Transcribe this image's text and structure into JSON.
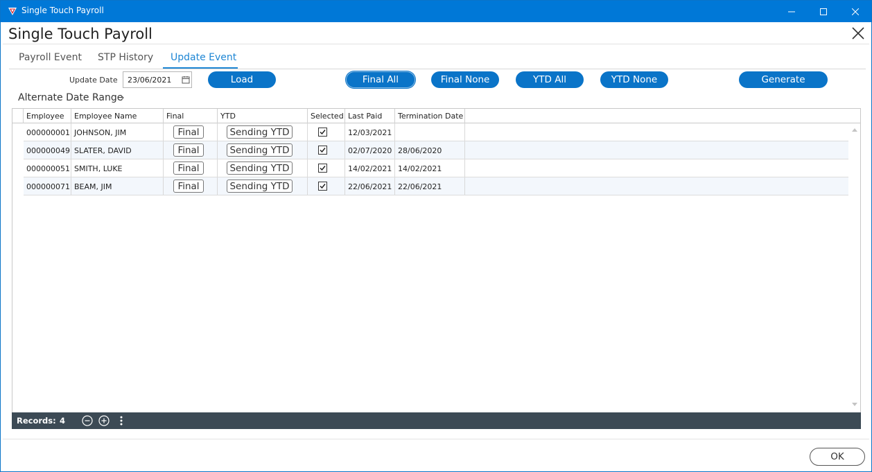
{
  "window": {
    "title": "Single Touch Payroll",
    "controls": [
      "minimize-icon",
      "maximize-icon",
      "close-icon"
    ],
    "accent": "#0078d7"
  },
  "dialog": {
    "title": "Single Touch Payroll"
  },
  "tabs": [
    {
      "label": "Payroll Event",
      "active": false
    },
    {
      "label": "STP History",
      "active": false
    },
    {
      "label": "Update Event",
      "active": true
    }
  ],
  "toolbar": {
    "update_date_label": "Update Date",
    "update_date_value": "23/06/2021",
    "load_label": "Load",
    "final_all_label": "Final All",
    "final_none_label": "Final None",
    "ytd_all_label": "YTD All",
    "ytd_none_label": "YTD None",
    "generate_label": "Generate"
  },
  "alternate_date_range": {
    "label": "Alternate Date Range"
  },
  "grid": {
    "columns": [
      "Employee",
      "Employee Name",
      "Final",
      "YTD",
      "Selected",
      "Last Paid",
      "Termination Date"
    ],
    "rows": [
      {
        "employee": "000000001",
        "name": "JOHNSON, JIM",
        "final": "Final",
        "ytd": "Sending YTD",
        "selected": true,
        "last_paid": "12/03/2021",
        "termination_date": ""
      },
      {
        "employee": "000000049",
        "name": "SLATER, DAVID",
        "final": "Final",
        "ytd": "Sending YTD",
        "selected": true,
        "last_paid": "02/07/2020",
        "termination_date": "28/06/2020"
      },
      {
        "employee": "000000051",
        "name": "SMITH, LUKE",
        "final": "Final",
        "ytd": "Sending YTD",
        "selected": true,
        "last_paid": "14/02/2021",
        "termination_date": "14/02/2021"
      },
      {
        "employee": "000000071",
        "name": "BEAM, JIM",
        "final": "Final",
        "ytd": "Sending YTD",
        "selected": true,
        "last_paid": "22/06/2021",
        "termination_date": "22/06/2021"
      }
    ]
  },
  "footer": {
    "records_label": "Records:",
    "records_count": "4"
  },
  "ok_label": "OK"
}
